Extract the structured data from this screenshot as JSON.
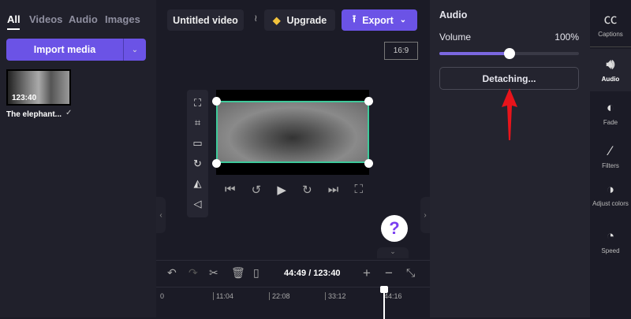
{
  "left_panel": {
    "tabs": [
      {
        "label": "All",
        "active": true
      },
      {
        "label": "Videos"
      },
      {
        "label": "Audio"
      },
      {
        "label": "Images"
      }
    ],
    "import_label": "Import media",
    "media": [
      {
        "duration": "123:40",
        "title": "The elephant...",
        "added": true
      }
    ]
  },
  "header": {
    "title": "Untitled video",
    "upgrade_label": "Upgrade",
    "export_label": "Export"
  },
  "preview": {
    "aspect_ratio": "16:9",
    "help": "?"
  },
  "timeline": {
    "time": "44:49 / 123:40",
    "ticks": [
      "0",
      "11:04",
      "22:08",
      "33:12",
      "44:16"
    ],
    "playhead_fraction": 0.362
  },
  "audio_panel": {
    "title": "Audio",
    "volume_label": "Volume",
    "volume_value": "100%",
    "volume_fraction": 0.5,
    "detach_label": "Detaching..."
  },
  "rail": [
    {
      "label": "Captions"
    },
    {
      "label": "Audio",
      "active": true
    },
    {
      "label": "Fade"
    },
    {
      "label": "Filters"
    },
    {
      "label": "Adjust colors"
    },
    {
      "label": "Speed"
    }
  ],
  "colors": {
    "accent": "#6b53e6",
    "selection": "#3ec99a",
    "arrow": "#e8141b"
  }
}
